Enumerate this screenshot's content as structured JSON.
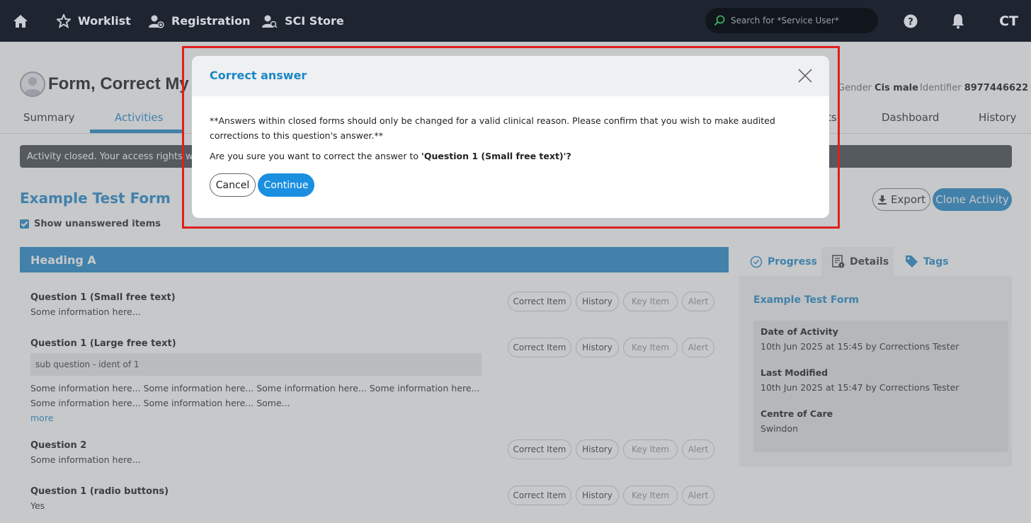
{
  "nav": {
    "worklist": "Worklist",
    "registration": "Registration",
    "sci_store": "SCI Store",
    "search_placeholder": "Search for *Service User*",
    "user_initials": "CT"
  },
  "patient": {
    "name": "Form, Correct My",
    "gender_label": "Gender",
    "gender_value": "Cis male",
    "identifier_label": "Identifier",
    "identifier_value": "8977446622"
  },
  "tabs": {
    "summary": "Summary",
    "activities": "Activities",
    "reports_fragment": "ts",
    "dashboard": "Dashboard",
    "history": "History"
  },
  "content": {
    "closed_notice": "Activity closed. Your access rights will al",
    "form_title": "Example Test Form",
    "show_unanswered": "Show unanswered items",
    "export_label": "Export",
    "clone_label": "Clone Activity",
    "heading": "Heading A"
  },
  "questions": [
    {
      "label": "Question 1 (Small free text)",
      "answer": "Some information here..."
    },
    {
      "label": "Question 1 (Large free text)",
      "sub_question": "sub question - ident of 1",
      "answer": "Some information here... Some information here... Some information here... Some information here... Some information here... Some information here... Some...",
      "more": "more"
    },
    {
      "label": "Question 2",
      "answer": "Some information here..."
    },
    {
      "label": "Question 1 (radio buttons)",
      "answer": "Yes"
    }
  ],
  "item_actions": {
    "correct": "Correct Item",
    "history": "History",
    "key": "Key Item",
    "alert": "Alert"
  },
  "side_panel": {
    "tabs": {
      "progress": "Progress",
      "details": "Details",
      "tags": "Tags"
    },
    "title": "Example Test Form",
    "date_label": "Date of Activity",
    "date_value": "10th Jun 2025 at 15:45 by Corrections Tester",
    "modified_label": "Last Modified",
    "modified_value": "10th Jun 2025 at 15:47 by Corrections Tester",
    "centre_label": "Centre of Care",
    "centre_value": "Swindon"
  },
  "modal": {
    "title": "Correct answer",
    "warning": "**Answers within closed forms should only be changed for a valid clinical reason. Please confirm that you wish to make audited corrections to this question's answer.**",
    "question_prefix": "Are you sure you want to correct the answer to ",
    "question_target": "'Question 1 (Small free text)'",
    "question_suffix": "?",
    "cancel": "Cancel",
    "continue": "Continue"
  },
  "colors": {
    "accent": "#1a86c8",
    "nav_bg": "#1e2530",
    "highlight": "#e0201e",
    "continue_bg": "#1a8fe0"
  }
}
